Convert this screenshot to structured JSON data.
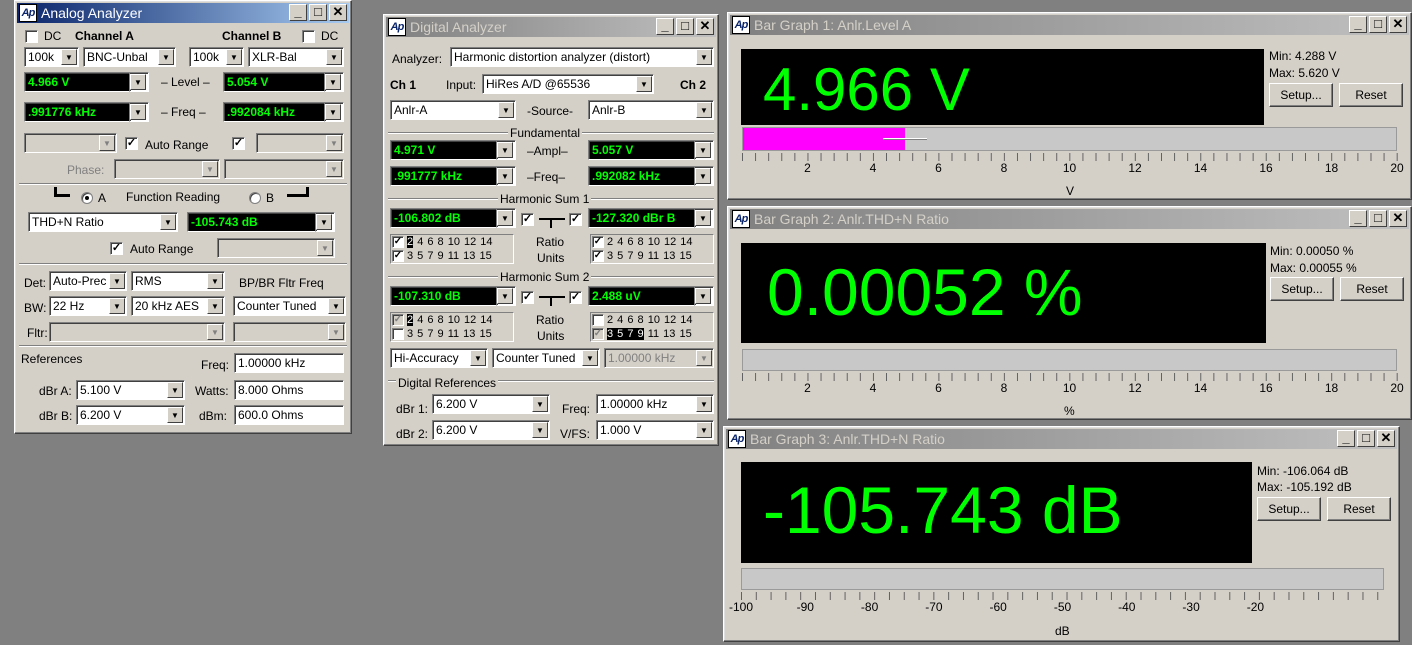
{
  "analog": {
    "title": "Analog Analyzer",
    "dc": "DC",
    "channel_a": "Channel A",
    "channel_b": "Channel B",
    "a_range": "100k",
    "a_input": "BNC-Unbal",
    "b_range": "100k",
    "b_input": "XLR-Bal",
    "a_level": "4.966  V",
    "level_label": "– Level –",
    "b_level": "5.054  V",
    "a_freq": ".991776 kHz",
    "freq_label": "– Freq –",
    "b_freq": ".992084 kHz",
    "auto_range": "Auto Range",
    "phase": "Phase:",
    "a_label": "A",
    "function_reading": "Function Reading",
    "b_label": "B",
    "function": "THD+N Ratio",
    "function_value": "-105.743 dB",
    "auto_range2": "Auto Range",
    "det_label": "Det:",
    "det": "Auto-Prec",
    "det_type": "RMS",
    "bpbr": "BP/BR Fltr Freq",
    "bw_label": "BW:",
    "bw_low": "22 Hz",
    "bw_high": "20 kHz AES",
    "bpbr_value": "Counter Tuned",
    "fltr_label": "Fltr:",
    "references": "References",
    "freq_ref_label": "Freq:",
    "freq_ref": "1.00000 kHz",
    "dbra_label": "dBr A:",
    "dbra": "5.100  V",
    "watts_label": "Watts:",
    "watts": "8.000    Ohms",
    "dbrb_label": "dBr B:",
    "dbrb": "6.200  V",
    "dbm_label": "dBm:",
    "dbm": "600.0    Ohms"
  },
  "digital": {
    "title": "Digital Analyzer",
    "analyzer_label": "Analyzer:",
    "analyzer": "Harmonic distortion analyzer (distort)",
    "ch1": "Ch 1",
    "input_label": "Input:",
    "input": "HiRes A/D @65536",
    "ch2": "Ch 2",
    "src1": "Anlr-A",
    "source_label": "-Source-",
    "src2": "Anlr-B",
    "fundamental": "Fundamental",
    "ampl1": "4.971  V",
    "ampl_label": "–Ampl–",
    "ampl2": "5.057  V",
    "freq1": ".991777 kHz",
    "freq_label": "–Freq–",
    "freq2": ".992082 kHz",
    "hs1": "Harmonic Sum 1",
    "hs1_a": "-106.802 dB",
    "hs1_b": "-127.320 dBr B",
    "hs2": "Harmonic Sum 2",
    "hs2_a": "-107.310 dB",
    "hs2_b": "2.488   uV",
    "ratio": "Ratio",
    "units": "Units",
    "even_rest": "4  6  8  10 12 14",
    "even_first": "2",
    "odd_rest": "3  5  7  9  11 13 15",
    "hs2b_even": "2  4  6  8  10 12 14",
    "hs2b_odd_hl": "3  5  7  9",
    "hs2b_odd_rest": "11 13 15",
    "accuracy": "Hi-Accuracy",
    "tuning": "Counter Tuned",
    "tune_freq": "1.00000 kHz",
    "digital_refs": "Digital References",
    "dbr1_label": "dBr 1:",
    "dbr1": "6.200   V",
    "freq_label2": "Freq:",
    "freq_ref": "1.00000 kHz",
    "dbr2_label": "dBr 2:",
    "dbr2": "6.200   V",
    "vfs_label": "V/FS:",
    "vfs": "1.000   V"
  },
  "bar1": {
    "title": "Bar Graph 1: Anlr.Level A",
    "value": "4.966      V",
    "min": "Min: 4.288   V",
    "max": "Max: 5.620   V",
    "unit": "V",
    "fill_fraction": 0.248,
    "ticks": [
      "2",
      "4",
      "6",
      "8",
      "10",
      "12",
      "14",
      "16",
      "18",
      "20"
    ]
  },
  "bar2": {
    "title": "Bar Graph 2: Anlr.THD+N Ratio",
    "value": "0.00052  %",
    "min": "Min: 0.00050  %",
    "max": "Max: 0.00055  %",
    "unit": "%",
    "ticks": [
      "2",
      "4",
      "6",
      "8",
      "10",
      "12",
      "14",
      "16",
      "18",
      "20"
    ]
  },
  "bar3": {
    "title": "Bar Graph 3: Anlr.THD+N Ratio",
    "value": "-105.743 dB",
    "min": "Min: -106.064 dB",
    "max": "Max: -105.192 dB",
    "unit": "dB",
    "ticks": [
      "-100",
      "-90",
      "-80",
      "-70",
      "-60",
      "-50",
      "-40",
      "-30",
      "-20"
    ]
  },
  "common": {
    "setup": "Setup...",
    "reset": "Reset",
    "min_btn": "_",
    "max_btn": "□",
    "close_btn": "✕",
    "ap": "Ap",
    "check": "✓",
    "dd": "▼"
  }
}
